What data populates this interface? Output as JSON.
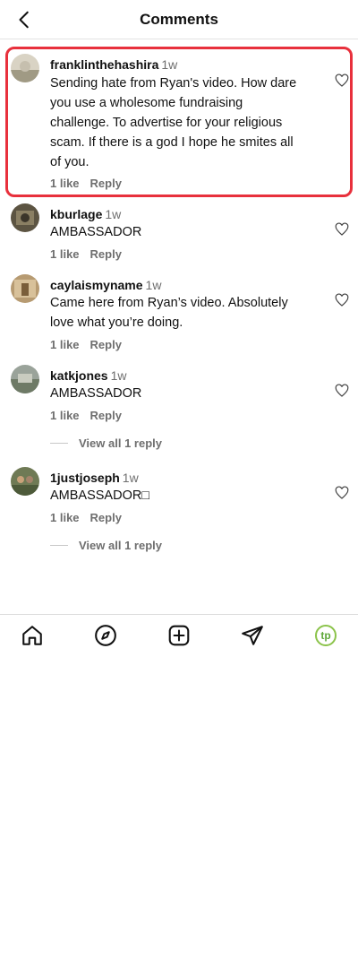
{
  "header": {
    "title": "Comments",
    "back_icon": "chevron-left-icon"
  },
  "comments": [
    {
      "username": "franklinthehashira",
      "time": "1w",
      "text": "Sending hate from Ryan's video. How dare you use a wholesome fundraising challenge. To advertise for your religious scam. If there is a god I hope he smites all of you.",
      "likes": "1 like",
      "reply": "Reply",
      "highlighted": true
    },
    {
      "username": "kburlage",
      "time": "1w",
      "text": "AMBASSADOR",
      "likes": "1 like",
      "reply": "Reply"
    },
    {
      "username": "caylaismyname",
      "time": "1w",
      "text": "Came here from Ryan’s video. Absolutely love what you’re doing.",
      "likes": "1 like",
      "reply": "Reply"
    },
    {
      "username": "katkjones",
      "time": "1w",
      "text": "AMBASSADOR",
      "likes": "1 like",
      "reply": "Reply",
      "view_replies": "View all 1 reply"
    },
    {
      "username": "1justjoseph",
      "time": "1w",
      "text": "AMBASSADOR□",
      "likes": "1 like",
      "reply": "Reply",
      "view_replies": "View all 1 reply"
    }
  ],
  "tabbar": {
    "items": [
      "home-icon",
      "explore-icon",
      "create-icon",
      "share-icon",
      "profile-avatar"
    ],
    "profile_initials": "tp"
  },
  "colors": {
    "highlight": "#e8303c",
    "muted": "#6e6e6e",
    "profile_accent": "#8bc34a"
  }
}
